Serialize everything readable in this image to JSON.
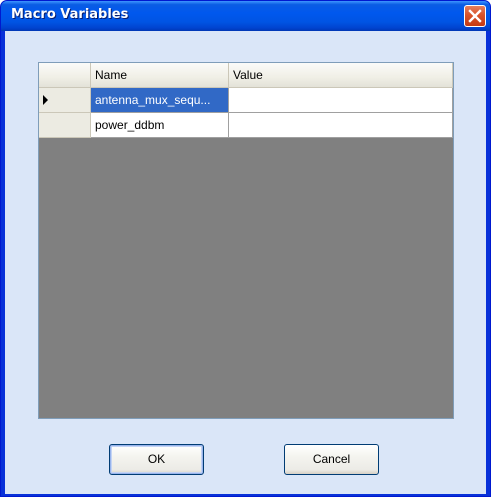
{
  "window": {
    "title": "Macro Variables"
  },
  "grid": {
    "columns": [
      "Name",
      "Value"
    ],
    "rows": [
      {
        "name": "antenna_mux_sequ...",
        "value": "",
        "current": true,
        "selected_cell": "name"
      },
      {
        "name": "power_ddbm",
        "value": "",
        "current": false
      }
    ]
  },
  "buttons": {
    "ok_label": "OK",
    "cancel_label": "Cancel"
  },
  "colors": {
    "titlebar": "#0054e3",
    "client_background": "#dae6f8",
    "grid_empty_area": "#808080",
    "selection": "#3169c6",
    "close_button": "#d9532a"
  },
  "icons": [
    "close-icon",
    "current-row-arrow-icon"
  ]
}
